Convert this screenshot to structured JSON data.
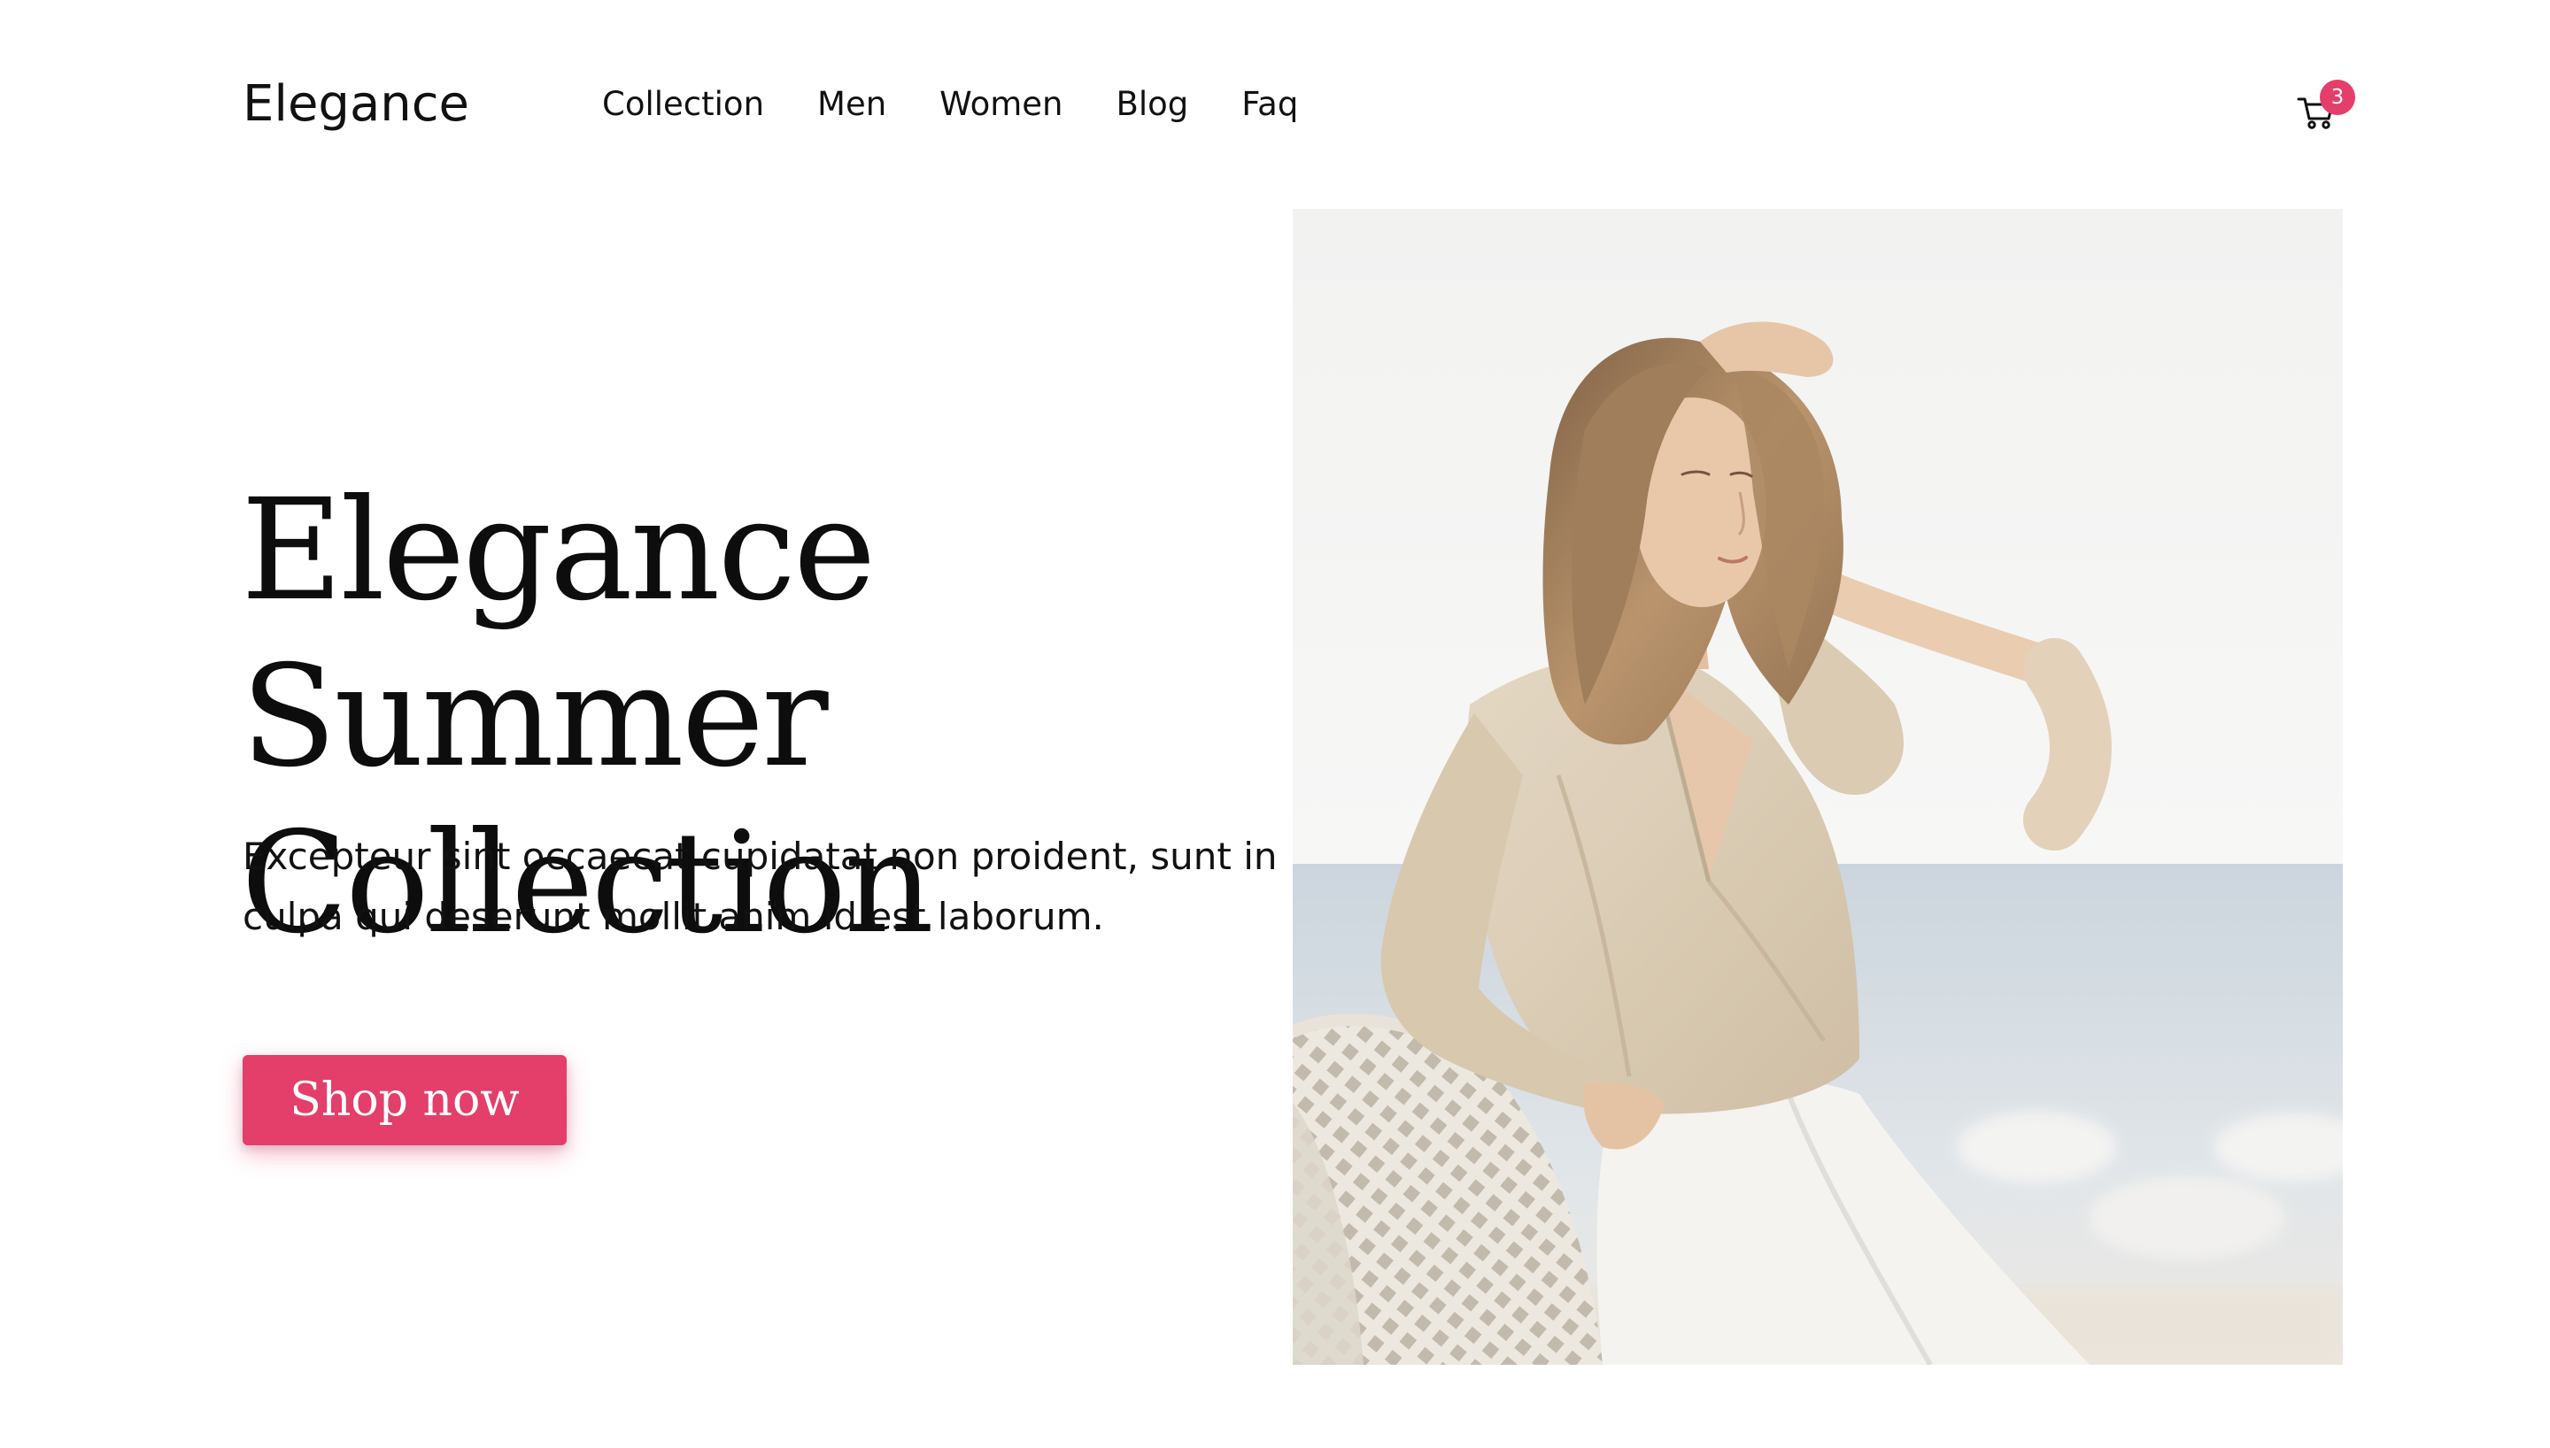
{
  "brand": {
    "name": "Elegance"
  },
  "nav": {
    "items": [
      {
        "label": "Collection"
      },
      {
        "label": "Men"
      },
      {
        "label": "Women"
      },
      {
        "label": "Blog"
      },
      {
        "label": "Faq"
      }
    ]
  },
  "cart": {
    "count": "3",
    "icon": "cart-icon"
  },
  "hero": {
    "title_line1": "Elegance Summer",
    "title_line2": "Collection",
    "description": "Excepteur sint occaecat cupidatat non proident, sunt in culpa qui deserunt mollit anim id est laborum.",
    "cta_label": "Shop now",
    "image_subject": "woman in beige blouse and white trousers by the sea"
  },
  "colors": {
    "accent": "#e43e6a",
    "text": "#111111",
    "background": "#ffffff"
  }
}
